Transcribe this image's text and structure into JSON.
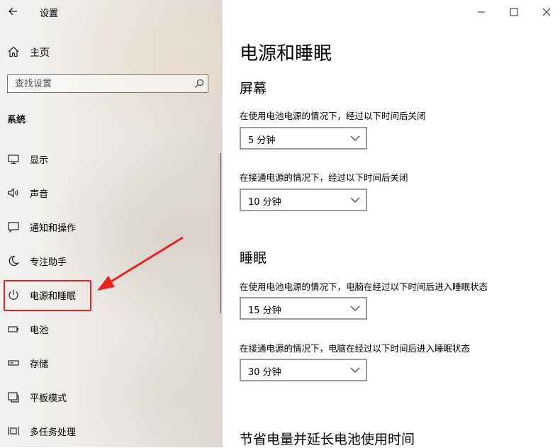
{
  "app": {
    "title": "设置"
  },
  "sidebar": {
    "home_label": "主页",
    "search_placeholder": "查找设置",
    "section_title": "系统",
    "items": [
      {
        "label": "显示",
        "icon": "monitor-icon"
      },
      {
        "label": "声音",
        "icon": "speaker-icon"
      },
      {
        "label": "通知和操作",
        "icon": "notification-icon"
      },
      {
        "label": "专注助手",
        "icon": "moon-icon"
      },
      {
        "label": "电源和睡眠",
        "icon": "power-icon",
        "selected": true
      },
      {
        "label": "电池",
        "icon": "battery-icon"
      },
      {
        "label": "存储",
        "icon": "storage-icon"
      },
      {
        "label": "平板模式",
        "icon": "tablet-icon"
      },
      {
        "label": "多任务处理",
        "icon": "multitask-icon"
      }
    ]
  },
  "main": {
    "title": "电源和睡眠",
    "screen": {
      "heading": "屏幕",
      "battery_desc": "在使用电池电源的情况下，经过以下时间后关闭",
      "battery_value": "5 分钟",
      "plugged_desc": "在接通电源的情况下，经过以下时间后关闭",
      "plugged_value": "10 分钟"
    },
    "sleep": {
      "heading": "睡眠",
      "battery_desc": "在使用电池电源的情况下，电脑在经过以下时间后进入睡眠状态",
      "battery_value": "15 分钟",
      "plugged_desc": "在接通电源的情况下，电脑在经过以下时间后进入睡眠状态",
      "plugged_value": "30 分钟"
    },
    "saver_heading": "节省电量并延长电池使用时间"
  },
  "colors": {
    "annotation": "#e8231f"
  }
}
